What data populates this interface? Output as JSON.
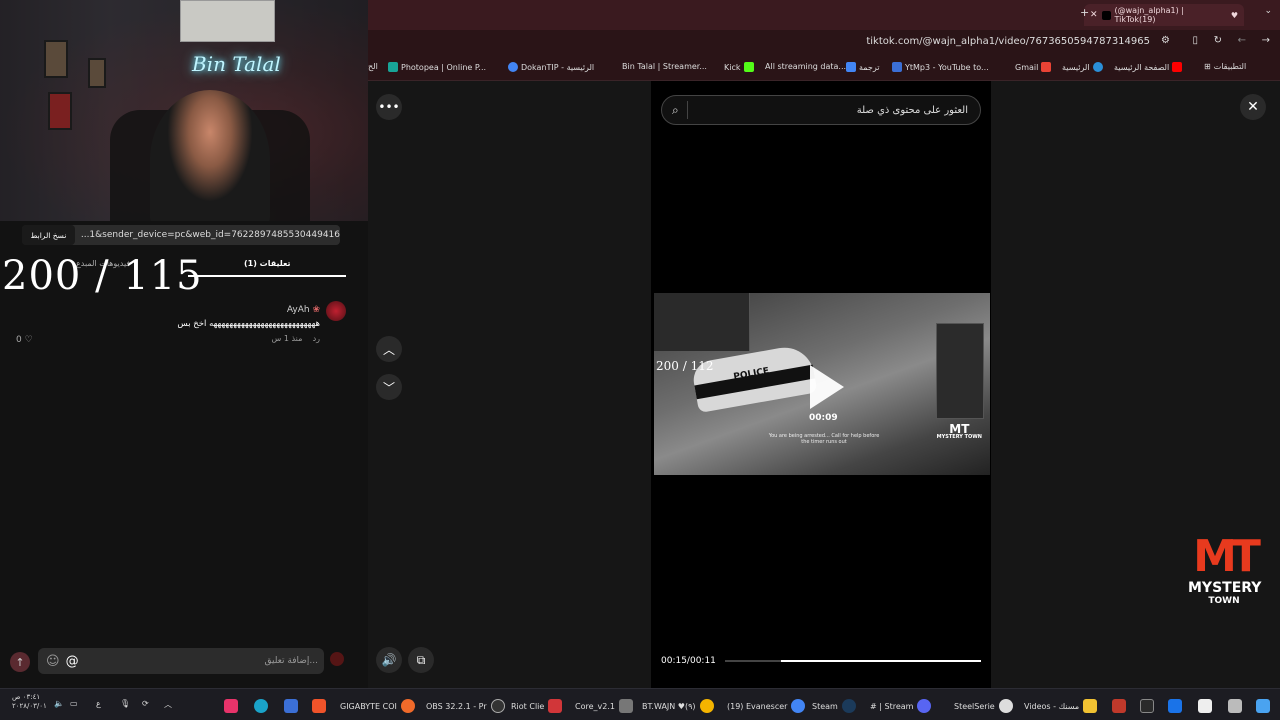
{
  "browser": {
    "tab_title": "(@wajn_alpha1) | TikTok(19)",
    "url": "tiktok.com/@wajn_alpha1/video/7673650594787314965",
    "new_tab": "+",
    "bookmarks": [
      "Photopea | Online P...",
      "DokanTIP - الرئيسية",
      "Bin Talal | Streamer...",
      "Kick",
      "All streaming data...",
      "ترجمة",
      "YtMp3 - YouTube to...",
      "Gmail",
      "الرئيسية",
      "الصفحة الرئيسية",
      "التطبيقات"
    ],
    "bookmark_left_cut": "الح"
  },
  "webcam": {
    "neon_sign": "Bin Talal"
  },
  "left_panel": {
    "link_text": "...1&sender_device=pc&web_id=7622897485530449416",
    "copy_label": "نسخ الرابط",
    "big_counter": "200 / 115",
    "tab_comments": "(1) تعليقات",
    "tab_creator": "فيديوهات المبدع",
    "comment": {
      "name": "AyAh",
      "text": "هههههههههههههههههههههههههههه اخخ بس",
      "time": "منذ 1 س",
      "reply": "رد",
      "likes": "0"
    },
    "input_placeholder": "إضافة تعليق...",
    "at_symbol": "@"
  },
  "player": {
    "search_placeholder": "العثور على محتوى ذي صلة",
    "video_counter": "200 / 112",
    "video_timestamp": "00:09",
    "video_car_text": "POLICE",
    "video_logo": "MT",
    "video_logo_sub": "MYSTERY TOWN",
    "video_caption": "You are being arrested... Call for help before the timer runs out",
    "time_display": "00:15/00:11",
    "progress": 0.22
  },
  "overlay_logo": {
    "mark": "MT",
    "name": "MYSTERY",
    "sub": "TOWN"
  },
  "taskbar": {
    "clock_time": "٠٣:٤١ ص",
    "clock_date": "٢٠٢٨/٠٣/٠١",
    "lang": "ع",
    "items": [
      "GIGABYTE COI",
      "OBS 32.2.1 - Pr",
      "Riot Clie",
      "Core_v2.1",
      "BT.WAJN ♥(٩)",
      "(19) Evanescer",
      "Steam",
      "# | Stream",
      "SteelSerie",
      "Videos - مسنك"
    ]
  },
  "colors": {
    "accent": "#e83a1e",
    "tab_bg": "#3a1a1f"
  }
}
